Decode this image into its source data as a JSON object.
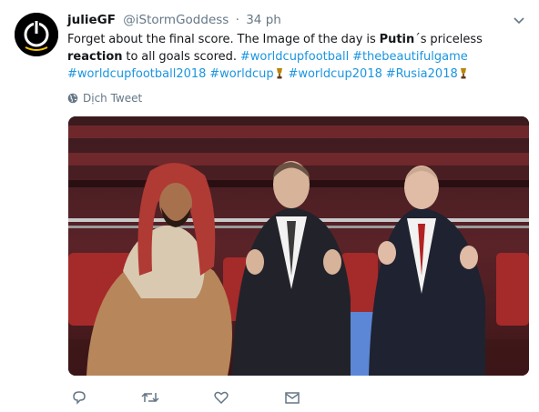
{
  "tweet": {
    "display_name": "julieGF",
    "handle": "@iStormGoddess",
    "separator": "·",
    "time": "34 ph",
    "text": {
      "t1": "Forget about the final score. The Image of the day is ",
      "t2": "Putin",
      "t3": "´s priceless ",
      "t4": "reaction",
      "t5": " to all goals scored. ",
      "h1": "#worldcupfootball",
      "h2": "#thebeautifulgame",
      "h3": "#worldcupfootball2018",
      "h4": "#worldcup",
      "h5": "#worldcup2018",
      "h6": "#Rusia2018"
    },
    "translate_label": "Dịch Tweet"
  },
  "icons": {
    "avatar": "power-icon",
    "caret": "chevron-down-icon",
    "translate": "globe-icon",
    "reply": "reply-icon",
    "retweet": "retweet-icon",
    "like": "heart-icon",
    "message": "envelope-icon",
    "emoji": "trophy-icon"
  },
  "colors": {
    "link": "#1b95e0",
    "secondary_text": "#657786",
    "text": "#14171a"
  }
}
